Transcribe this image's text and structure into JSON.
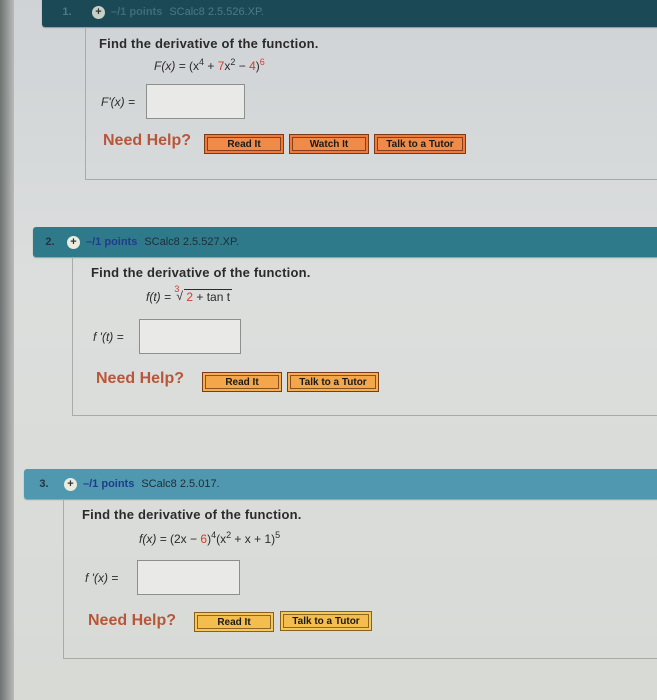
{
  "questions": [
    {
      "number": "1.",
      "points": "–/1 points",
      "code": "SCalc8 2.5.526.XP.",
      "prompt": "Find the derivative of the function.",
      "function_lhs": "F(x) = ",
      "function_parts": [
        "(x",
        "4",
        " + ",
        "7",
        "x",
        "2",
        " − ",
        "4",
        ")",
        "6"
      ],
      "answer_label": "F'(x) =",
      "answer_value": "",
      "need_help": "Need Help?",
      "buttons": [
        "Read It",
        "Watch It",
        "Talk to a Tutor"
      ]
    },
    {
      "number": "2.",
      "points": "–/1 points",
      "code": "SCalc8 2.5.527.XP.",
      "prompt": "Find the derivative of the function.",
      "function_lhs": "f(t) = ",
      "root_index": "3",
      "radicand_red": "2",
      "radicand_rest": " + tan t",
      "answer_label": "f '(t) =",
      "answer_value": "",
      "need_help": "Need Help?",
      "buttons": [
        "Read It",
        "Talk to a Tutor"
      ]
    },
    {
      "number": "3.",
      "points": "–/1 points",
      "code": "SCalc8 2.5.017.",
      "prompt": "Find the derivative of the function.",
      "function_lhs": "f(x) = ",
      "function_parts": [
        "(2x − ",
        "6",
        ")",
        "4",
        "(x",
        "2",
        " + x + 1)",
        "5"
      ],
      "answer_label": "f '(x) =",
      "answer_value": "",
      "need_help": "Need Help?",
      "buttons": [
        "Read It",
        "Talk to a Tutor"
      ]
    }
  ],
  "colors": {
    "header_q1": "#1b4a56",
    "header_q2": "#2f7a8a",
    "header_q3": "#4f98b0",
    "need_help": "#b8563a",
    "accent_red": "#d53c2c"
  }
}
